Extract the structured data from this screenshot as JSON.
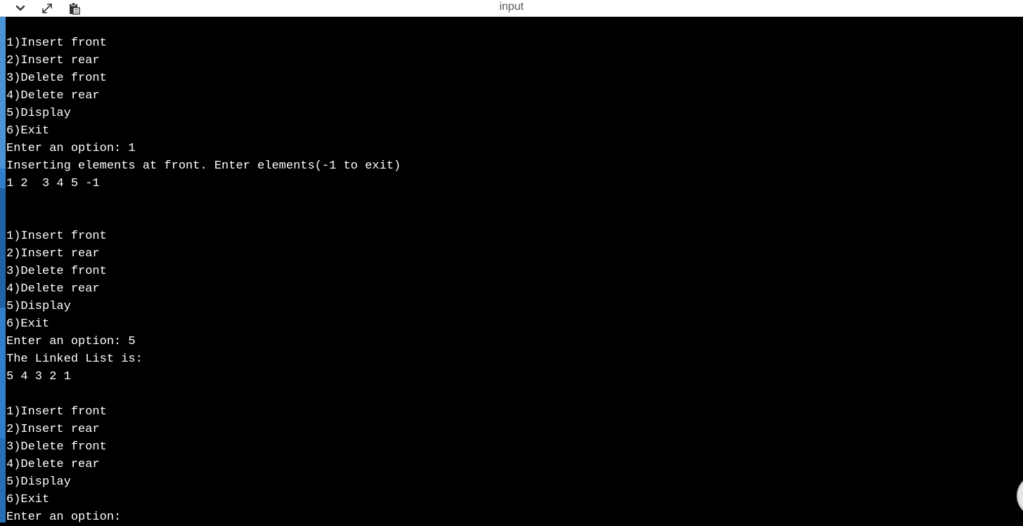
{
  "window": {
    "title": "input",
    "controls": [
      {
        "name": "collapse-button",
        "icon": "chevron-down-icon"
      },
      {
        "name": "expand-button",
        "icon": "expand-arrows-icon"
      },
      {
        "name": "clipboard-button",
        "icon": "clipboard-icon"
      }
    ]
  },
  "console": {
    "lines": [
      "1)Insert front",
      "2)Insert rear",
      "3)Delete front",
      "4)Delete rear",
      "5)Display",
      "6)Exit",
      "Enter an option: 1",
      "Inserting elements at front. Enter elements(-1 to exit)",
      "1 2  3 4 5 -1",
      "",
      "",
      "1)Insert front",
      "2)Insert rear",
      "3)Delete front",
      "4)Delete rear",
      "5)Display",
      "6)Exit",
      "Enter an option: 5",
      "The Linked List is:",
      "5 4 3 2 1",
      "",
      "1)Insert front",
      "2)Insert rear",
      "3)Delete front",
      "4)Delete rear",
      "5)Display",
      "6)Exit",
      "Enter an option:"
    ]
  },
  "colors": {
    "background": "#000000",
    "text": "#ffffff",
    "titlebar": "#ffffff",
    "title_text": "#5a5a5a",
    "side_strip": "#2f7fc9"
  }
}
